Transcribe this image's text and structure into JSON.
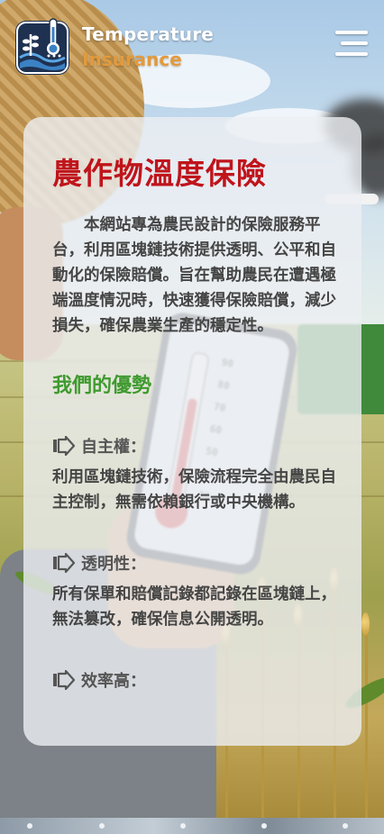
{
  "header": {
    "brand_line1": "Temperature",
    "brand_line2": "Insurance",
    "logo_icon": "thermometer-plant-logo",
    "menu_icon": "hamburger-menu-icon"
  },
  "content": {
    "title": "農作物溫度保險",
    "intro": "本網站專為農民設計的保險服務平台，利用區塊鏈技術提供透明、公平和自動化的保險賠償。旨在幫助農民在遭遇極端溫度情況時，快速獲得保險賠償，減少損失，確保農業生產的穩定性。",
    "advantages_title": "我們的優勢",
    "advantages": [
      {
        "heading": "自主權：",
        "body": "利用區塊鏈技術，保險流程完全由農民自主控制，無需依賴銀行或中央機構。"
      },
      {
        "heading": "透明性：",
        "body": "所有保單和賠償記錄都記錄在區塊鏈上，無法篡改，確保信息公開透明。"
      },
      {
        "heading": "效率高：",
        "body": ""
      }
    ]
  },
  "colors": {
    "title": "#c0141b",
    "section_title": "#3f9a2f",
    "brand_accent": "#e39a3c",
    "text": "#454545"
  }
}
